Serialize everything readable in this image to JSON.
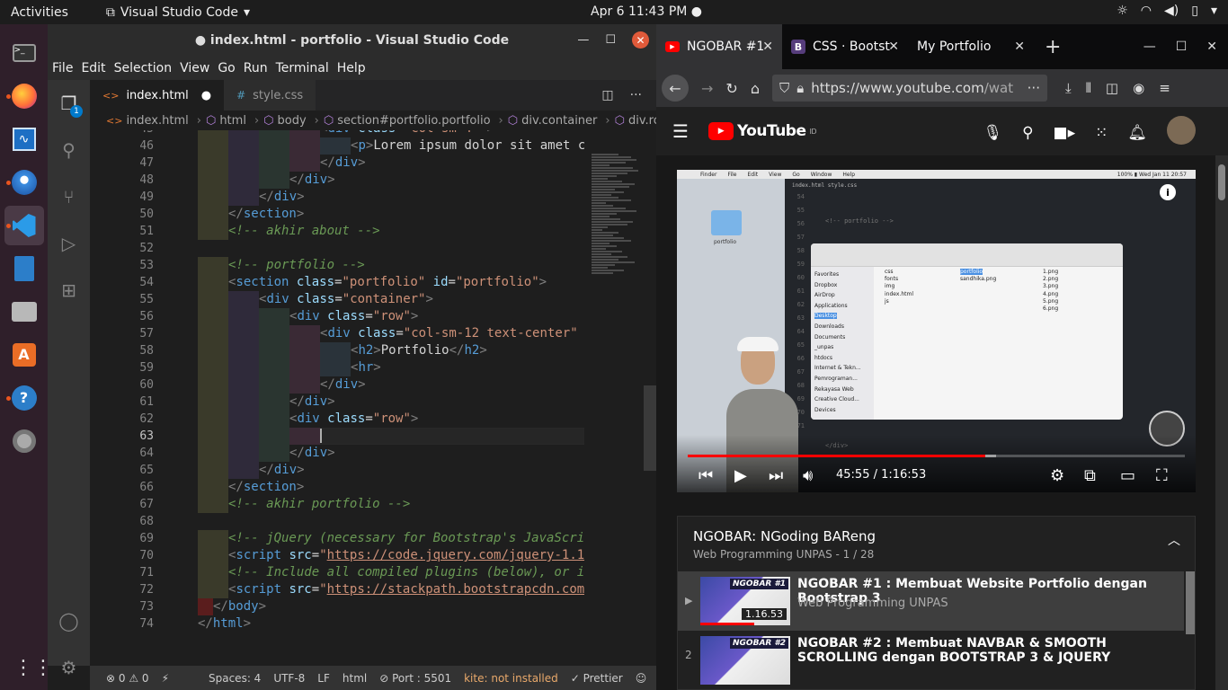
{
  "topbar": {
    "activities": "Activities",
    "app_name": "Visual Studio Code",
    "clock": "Apr 6  11:43 PM"
  },
  "dock": {
    "apps": [
      "terminal-icon",
      "firefox-icon",
      "system-monitor-icon",
      "thunderbird-icon",
      "vscode-icon",
      "libreoffice-writer-icon",
      "files-icon",
      "software-center-icon",
      "help-icon",
      "disk-icon"
    ]
  },
  "vscode": {
    "title": "● index.html - portfolio - Visual Studio Code",
    "menu": [
      "File",
      "Edit",
      "Selection",
      "View",
      "Go",
      "Run",
      "Terminal",
      "Help"
    ],
    "explorer_badge": "1",
    "tabs": [
      {
        "icon": "<>",
        "label": "index.html",
        "modified": "●"
      },
      {
        "icon": "#",
        "label": "style.css"
      }
    ],
    "breadcrumb": [
      "index.html",
      "html",
      "body",
      "section#portfolio.portfolio",
      "div.container",
      "div.row"
    ],
    "current_line": 63,
    "status": {
      "errors": "⊗ 0",
      "warnings": "⚠ 0",
      "spaces": "Spaces: 4",
      "encoding": "UTF-8",
      "eol": "LF",
      "language": "html",
      "port": "Port : 5501",
      "kite": "kite: not installed",
      "prettier": "✓ Prettier"
    }
  },
  "browser": {
    "tabs": [
      {
        "label": "NGOBAR #1"
      },
      {
        "label": "CSS · Bootst"
      },
      {
        "label": "My Portfolio"
      }
    ],
    "url_host": "https://www.youtube.com",
    "url_rest": "/wat",
    "youtube": {
      "logo": "YouTube",
      "logo_suffix": "ID",
      "video": {
        "time": "45:55 / 1:16:53",
        "progress": 0.598
      },
      "playlist": {
        "title": "NGOBAR: NGoding BAReng",
        "subtitle": "Web Programming UNPAS - 1 / 28",
        "items": [
          {
            "index": "▶",
            "title": "NGOBAR #1 : Membuat Website Portfolio dengan Bootstrap 3",
            "channel": "Web Programming UNPAS",
            "duration": "1.16.53",
            "thumb_label": "NGOBAR #1",
            "watched": 0.6
          },
          {
            "index": "2",
            "title": "NGOBAR #2 : Membuat NAVBAR & SMOOTH SCROLLING dengan BOOTSTRAP 3 & JQUERY",
            "channel": "",
            "duration": "",
            "thumb_label": "NGOBAR #2",
            "watched": 0
          }
        ]
      }
    }
  }
}
